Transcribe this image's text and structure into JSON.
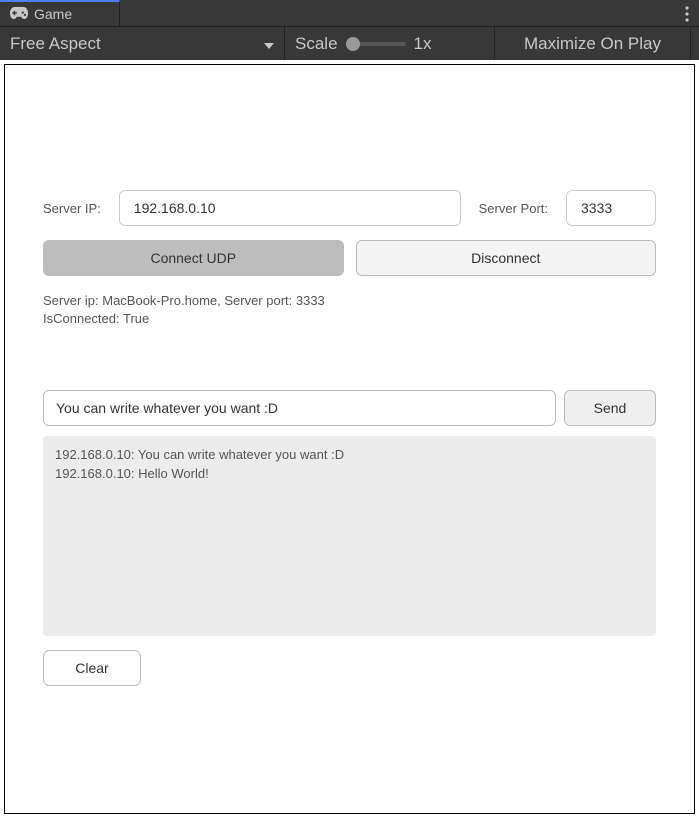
{
  "tab": {
    "label": "Game"
  },
  "toolbar": {
    "aspect": "Free Aspect",
    "scaleLabel": "Scale",
    "scaleValue": "1x",
    "maximize": "Maximize On Play"
  },
  "form": {
    "serverIpLabel": "Server IP:",
    "serverIpValue": "192.168.0.10",
    "serverPortLabel": "Server Port:",
    "serverPortValue": "3333",
    "connectLabel": "Connect UDP",
    "disconnectLabel": "Disconnect"
  },
  "status": {
    "line1": "Server ip: MacBook-Pro.home, Server port: 3333",
    "line2": "IsConnected: True"
  },
  "message": {
    "inputValue": "You can write whatever you want :D",
    "sendLabel": "Send"
  },
  "log": {
    "lines": [
      "192.168.0.10: You can write whatever you want :D",
      "192.168.0.10: Hello World!"
    ]
  },
  "clearLabel": "Clear"
}
